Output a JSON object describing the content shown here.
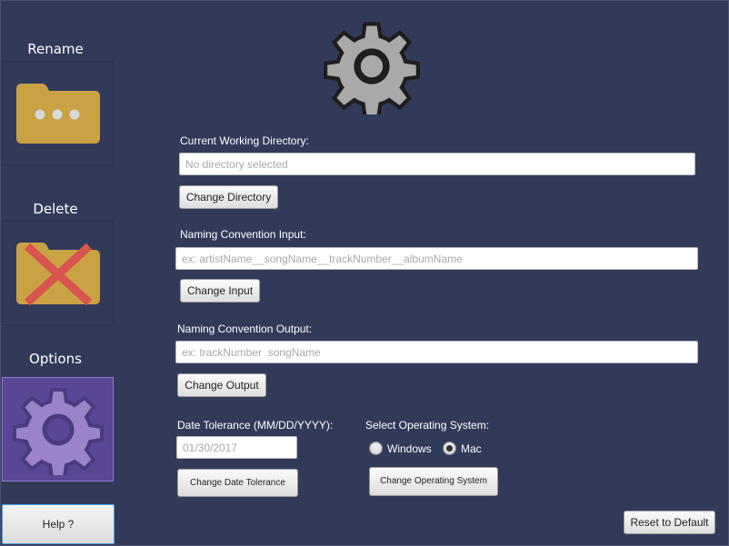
{
  "sidebar": {
    "rename_label": "Rename",
    "delete_label": "Delete",
    "options_label": "Options",
    "help_label": "Help ?"
  },
  "options": {
    "working_dir": {
      "label": "Current Working Directory:",
      "placeholder": "No directory selected",
      "button": "Change Directory"
    },
    "naming_input": {
      "label": "Naming Convention Input:",
      "placeholder": "ex: artistName__songName__trackNumber__albumName",
      "button": "Change Input"
    },
    "naming_output": {
      "label": "Naming Convention Output:",
      "placeholder": "ex: trackNumber  songName",
      "button": "Change Output"
    },
    "date_tolerance": {
      "label": "Date Tolerance (MM/DD/YYYY):",
      "placeholder": "01/30/2017",
      "button": "Change Date Tolerance"
    },
    "os": {
      "label": "Select Operating System:",
      "windows_label": "Windows",
      "mac_label": "Mac",
      "selected": "Mac",
      "button": "Change Operating System"
    },
    "reset_button": "Reset to Default"
  },
  "colors": {
    "background": "#323a5a",
    "folder": "#c9a244",
    "active_tile": "#5a4596",
    "gear_large": "#a9a9a9",
    "gear_purple": "#9b83c9"
  },
  "icons": {
    "header": "gear-icon",
    "rename": "folder-dots-icon",
    "delete": "folder-x-icon",
    "options": "gear-icon"
  }
}
